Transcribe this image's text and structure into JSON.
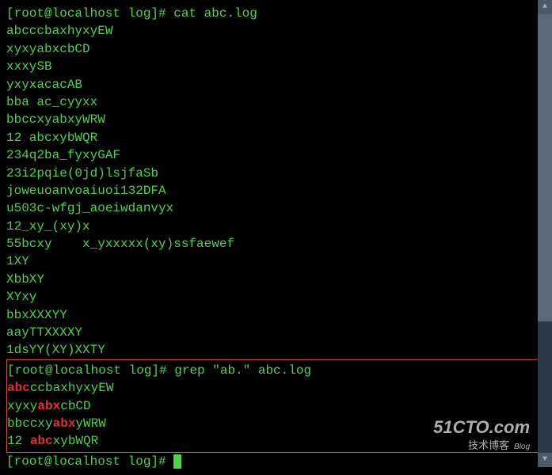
{
  "prompt1": {
    "prefix": "[root@localhost log]# ",
    "command": "cat abc.log"
  },
  "cat_output": [
    "abcccbaxhyxyEW",
    "xyxyabxcbCD",
    "xxxySB",
    "yxyxacacAB",
    "bba ac_cyyxx",
    "bbccxyabxyWRW",
    "12 abcxybWQR",
    "234q2ba_fyxyGAF",
    "23i2pqie(0jd)lsjfaSb",
    "joweuoanvoaiuoi132DFA",
    "u503c-wfgj_aoeiwdanvyx",
    "12_xy_(xy)x",
    "55bcxy    x_yxxxxx(xy)ssfaewef",
    "1XY",
    "",
    "XbbXY",
    "XYxy",
    "bbxXXXYY",
    "aayTTXXXXY",
    "1dsYY(XY)XXTY"
  ],
  "prompt2": {
    "prefix": "[root@localhost log]# ",
    "command": "grep \"ab.\" abc.log"
  },
  "grep_output": [
    {
      "pre": "",
      "match": "abc",
      "post": "ccbaxhyxyEW"
    },
    {
      "pre": "xyxy",
      "match": "abx",
      "post": "cbCD"
    },
    {
      "pre": "bbccxy",
      "match": "abx",
      "post": "yWRW"
    },
    {
      "pre": "12 ",
      "match": "abc",
      "post": "xybWQR"
    }
  ],
  "prompt3": {
    "prefix": "[root@localhost log]# "
  },
  "watermark": {
    "main": "51CTO.com",
    "sub": "技术博客",
    "blog": "Blog"
  }
}
